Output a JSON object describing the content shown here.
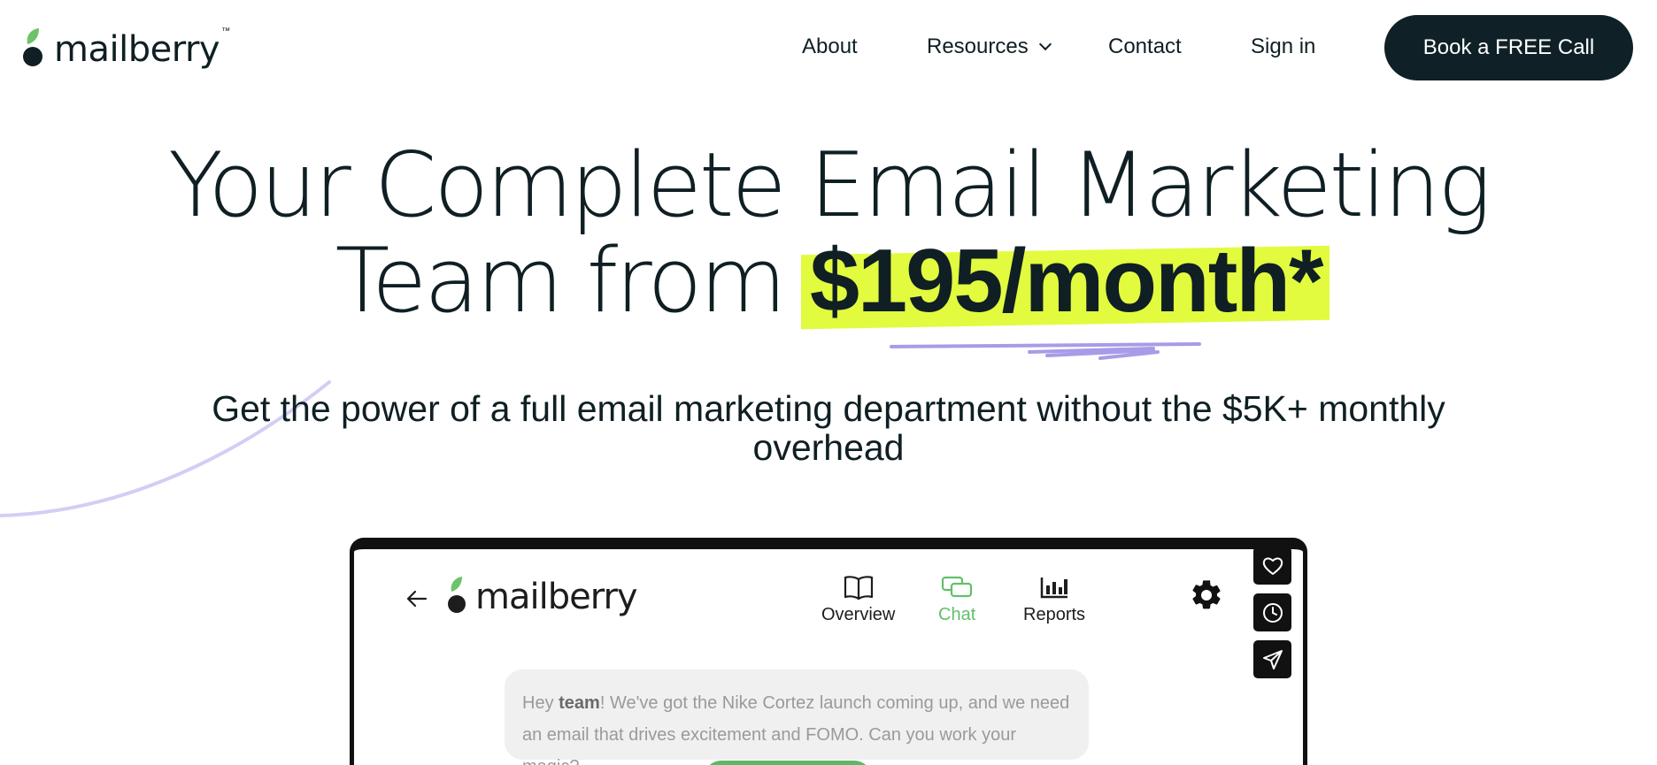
{
  "brand": {
    "name": "mailberry",
    "tm": "™"
  },
  "nav": {
    "items": [
      "About",
      "Resources",
      "Contact",
      "Sign in"
    ],
    "cta_label": "Book a FREE Call"
  },
  "hero": {
    "line1": "Your Complete Email Marketing",
    "line2_prefix": "Team from ",
    "price": "$195/month*",
    "subtitle": "Get the power of a full email marketing department without the $5K+ monthly overhead",
    "highlight_color": "#e2fb3f",
    "accent_line_color": "#a89be8"
  },
  "app": {
    "brand": "mailberry",
    "tabs": [
      {
        "label": "Overview",
        "icon": "book-icon"
      },
      {
        "label": "Chat",
        "icon": "chat-icon",
        "active": true
      },
      {
        "label": "Reports",
        "icon": "bar-chart-icon"
      }
    ],
    "side_buttons": [
      "heart-icon",
      "clock-icon",
      "send-icon"
    ],
    "message": {
      "pre": "Hey ",
      "bold": "team",
      "post": "! We've got the Nike Cortez launch coming up, and we need an email that drives excitement and FOMO. Can you work your magic?"
    }
  },
  "colors": {
    "dark": "#0f2127",
    "green": "#5cb865",
    "lime": "#e2fb3f"
  }
}
